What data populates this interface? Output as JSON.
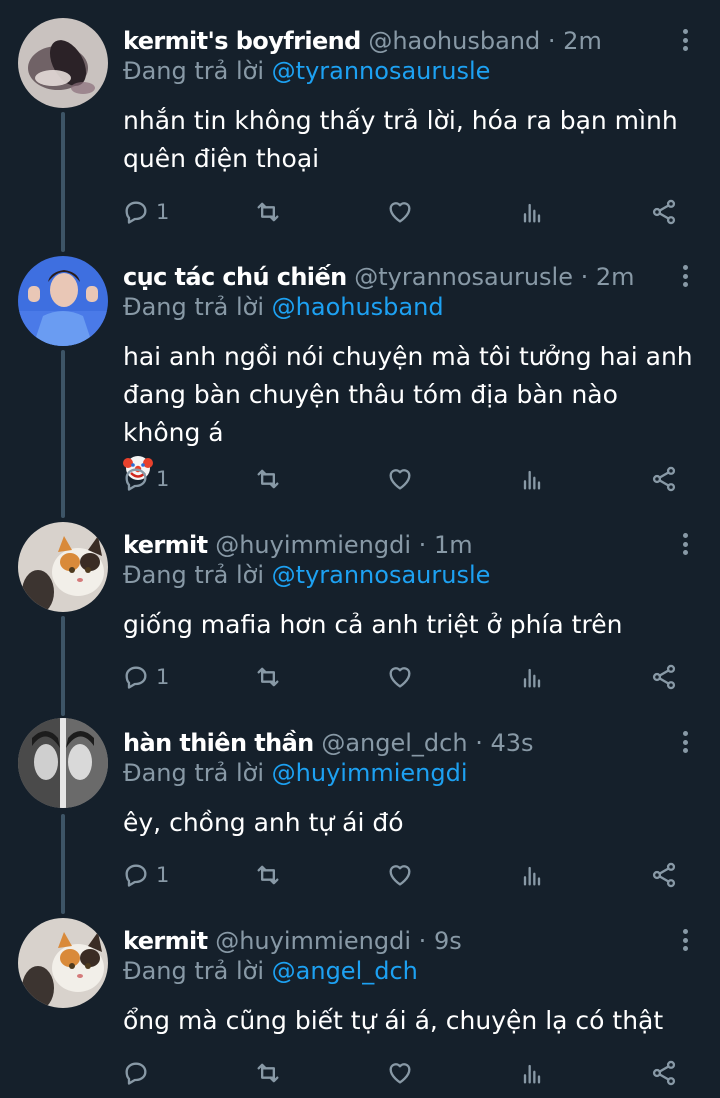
{
  "app": {
    "reply_prefix": "Đang trả lời"
  },
  "tweets": [
    {
      "name": "kermit's boyfriend",
      "handle": "@haohusband",
      "time": "2m",
      "reply_to": "@tyrannosaurusle",
      "text_lines": [
        "nhắn tin không thấy trả lời, hóa ra bạn mình",
        "quên điện thoại"
      ],
      "reply_count": "1",
      "avatar": "blurry-photo-avatar"
    },
    {
      "name": "cục tác chú chiến",
      "handle": "@tyrannosaurusle",
      "time": "2m",
      "reply_to": "@haohusband",
      "text_lines": [
        "hai anh ngồi nói chuyện mà tôi tưởng hai anh",
        "đang bàn chuyện thâu tóm địa bàn nào không á"
      ],
      "emoji": "clown-face-emoji",
      "reply_count": "1",
      "avatar": "person-blue-background-avatar"
    },
    {
      "name": "kermit",
      "handle": "@huyimmiengdi",
      "time": "1m",
      "reply_to": "@tyrannosaurusle",
      "text_lines": [
        "giống mafia hơn cả anh triệt ở phía trên"
      ],
      "reply_count": "1",
      "avatar": "cat-avatar"
    },
    {
      "name": "hàn thiên thần",
      "handle": "@angel_dch",
      "time": "43s",
      "reply_to": "@huyimmiengdi",
      "text_lines": [
        "êy, chồng anh tự ái đó"
      ],
      "reply_count": "1",
      "avatar": "two-faces-avatar"
    },
    {
      "name": "kermit",
      "handle": "@huyimmiengdi",
      "time": "9s",
      "reply_to": "@angel_dch",
      "text_lines": [
        "ổng mà cũng biết tự ái á, chuyện lạ có thật"
      ],
      "reply_count": "",
      "avatar": "cat-avatar"
    }
  ],
  "colors": {
    "background": "#15202b",
    "secondary_text": "#8899a6",
    "link": "#1da1f2",
    "thread_line": "#3d5466"
  },
  "icons": [
    "reply-icon",
    "retweet-icon",
    "like-icon",
    "analytics-icon",
    "share-icon",
    "more-options-icon"
  ]
}
